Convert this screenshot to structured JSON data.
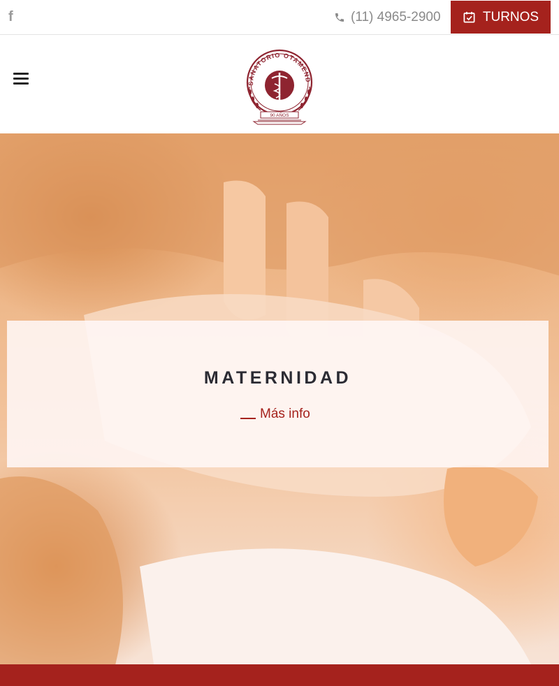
{
  "topbar": {
    "facebook_icon": "f",
    "phone_number": "(11) 4965-2900",
    "turnos_label": "TURNOS"
  },
  "header": {
    "logo_text": "SANATORIO OTAMENDI",
    "logo_subtext": "90 AÑOS"
  },
  "hero": {
    "title": "MATERNIDAD",
    "more_label": "Más info"
  },
  "colors": {
    "brand": "#a5221d",
    "text_dark": "#2b2b33",
    "muted": "#8a8a8a"
  },
  "icons": {
    "facebook": "facebook-icon",
    "phone": "phone-icon",
    "calendar": "calendar-check-icon",
    "menu": "hamburger-icon",
    "logo": "caduceus-seal-icon"
  }
}
